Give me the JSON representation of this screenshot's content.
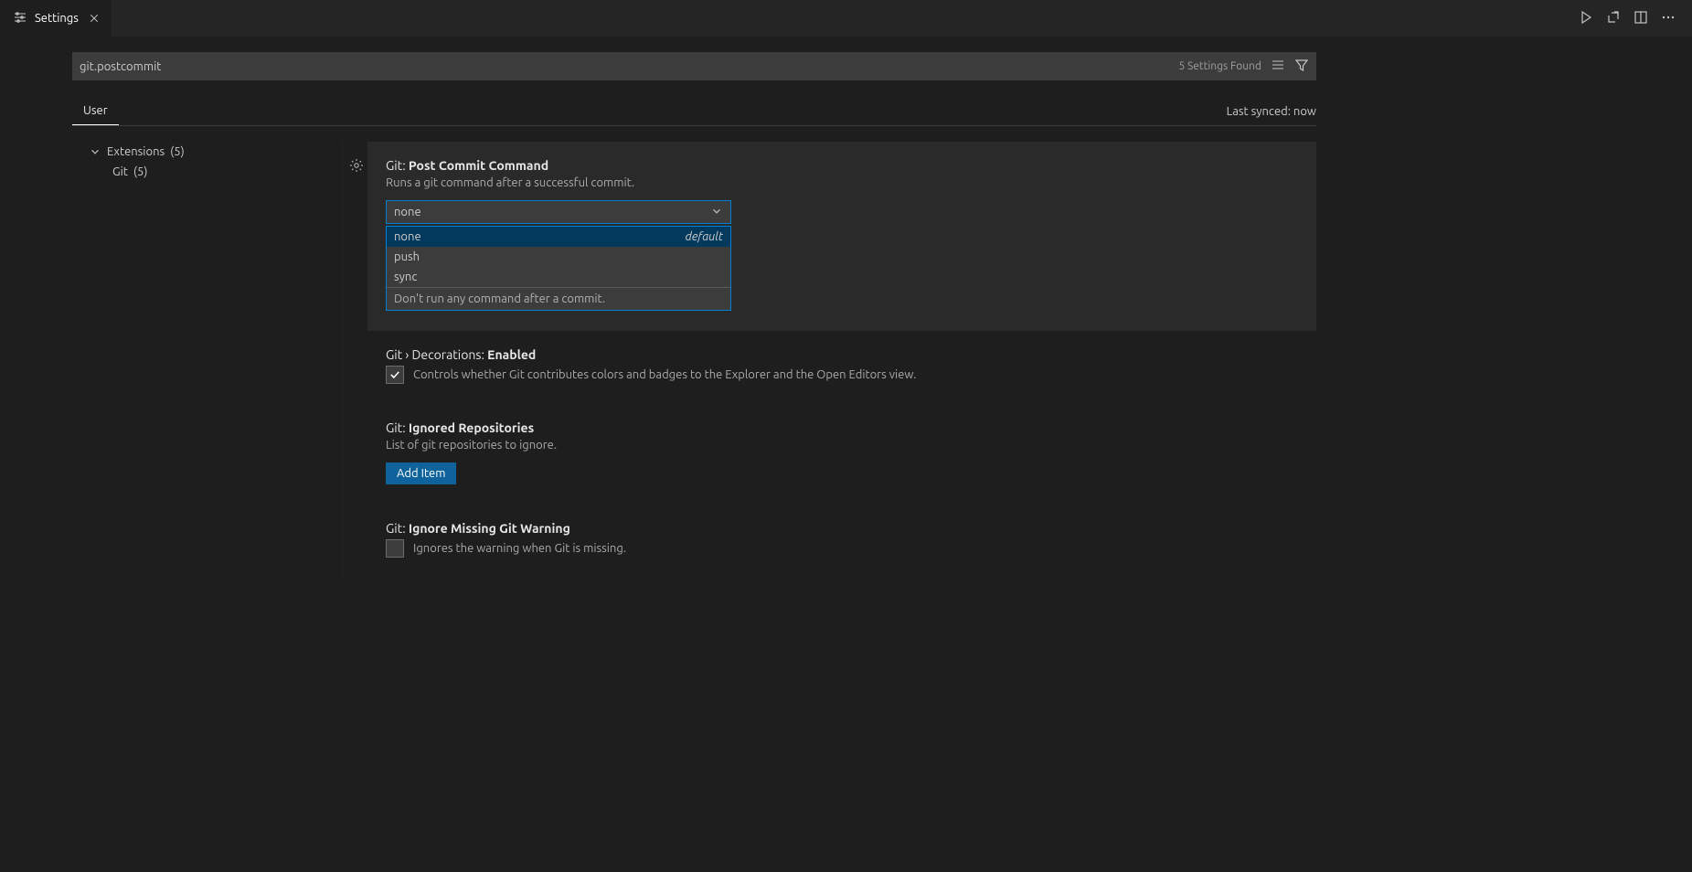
{
  "tab": {
    "title": "Settings"
  },
  "search": {
    "value": "git.postcommit",
    "results": "5 Settings Found"
  },
  "scope": {
    "tab": "User",
    "sync": "Last synced: now"
  },
  "tree": {
    "parent_label": "Extensions",
    "parent_count": "(5)",
    "child_label": "Git",
    "child_count": "(5)"
  },
  "settings": {
    "postCommit": {
      "prefix": "Git: ",
      "title": "Post Commit Command",
      "desc": "Runs a git command after a successful commit.",
      "selected": "none",
      "options": [
        {
          "value": "none",
          "default": "default"
        },
        {
          "value": "push",
          "default": ""
        },
        {
          "value": "sync",
          "default": ""
        }
      ],
      "hint": "Don't run any command after a commit."
    },
    "decorations": {
      "prefix": "Git › Decorations: ",
      "title": "Enabled",
      "desc": "Controls whether Git contributes colors and badges to the Explorer and the Open Editors view."
    },
    "ignoredRepos": {
      "prefix": "Git: ",
      "title": "Ignored Repositories",
      "desc": "List of git repositories to ignore.",
      "button": "Add Item"
    },
    "ignoreMissing": {
      "prefix": "Git: ",
      "title": "Ignore Missing Git Warning",
      "desc": "Ignores the warning when Git is missing."
    }
  }
}
